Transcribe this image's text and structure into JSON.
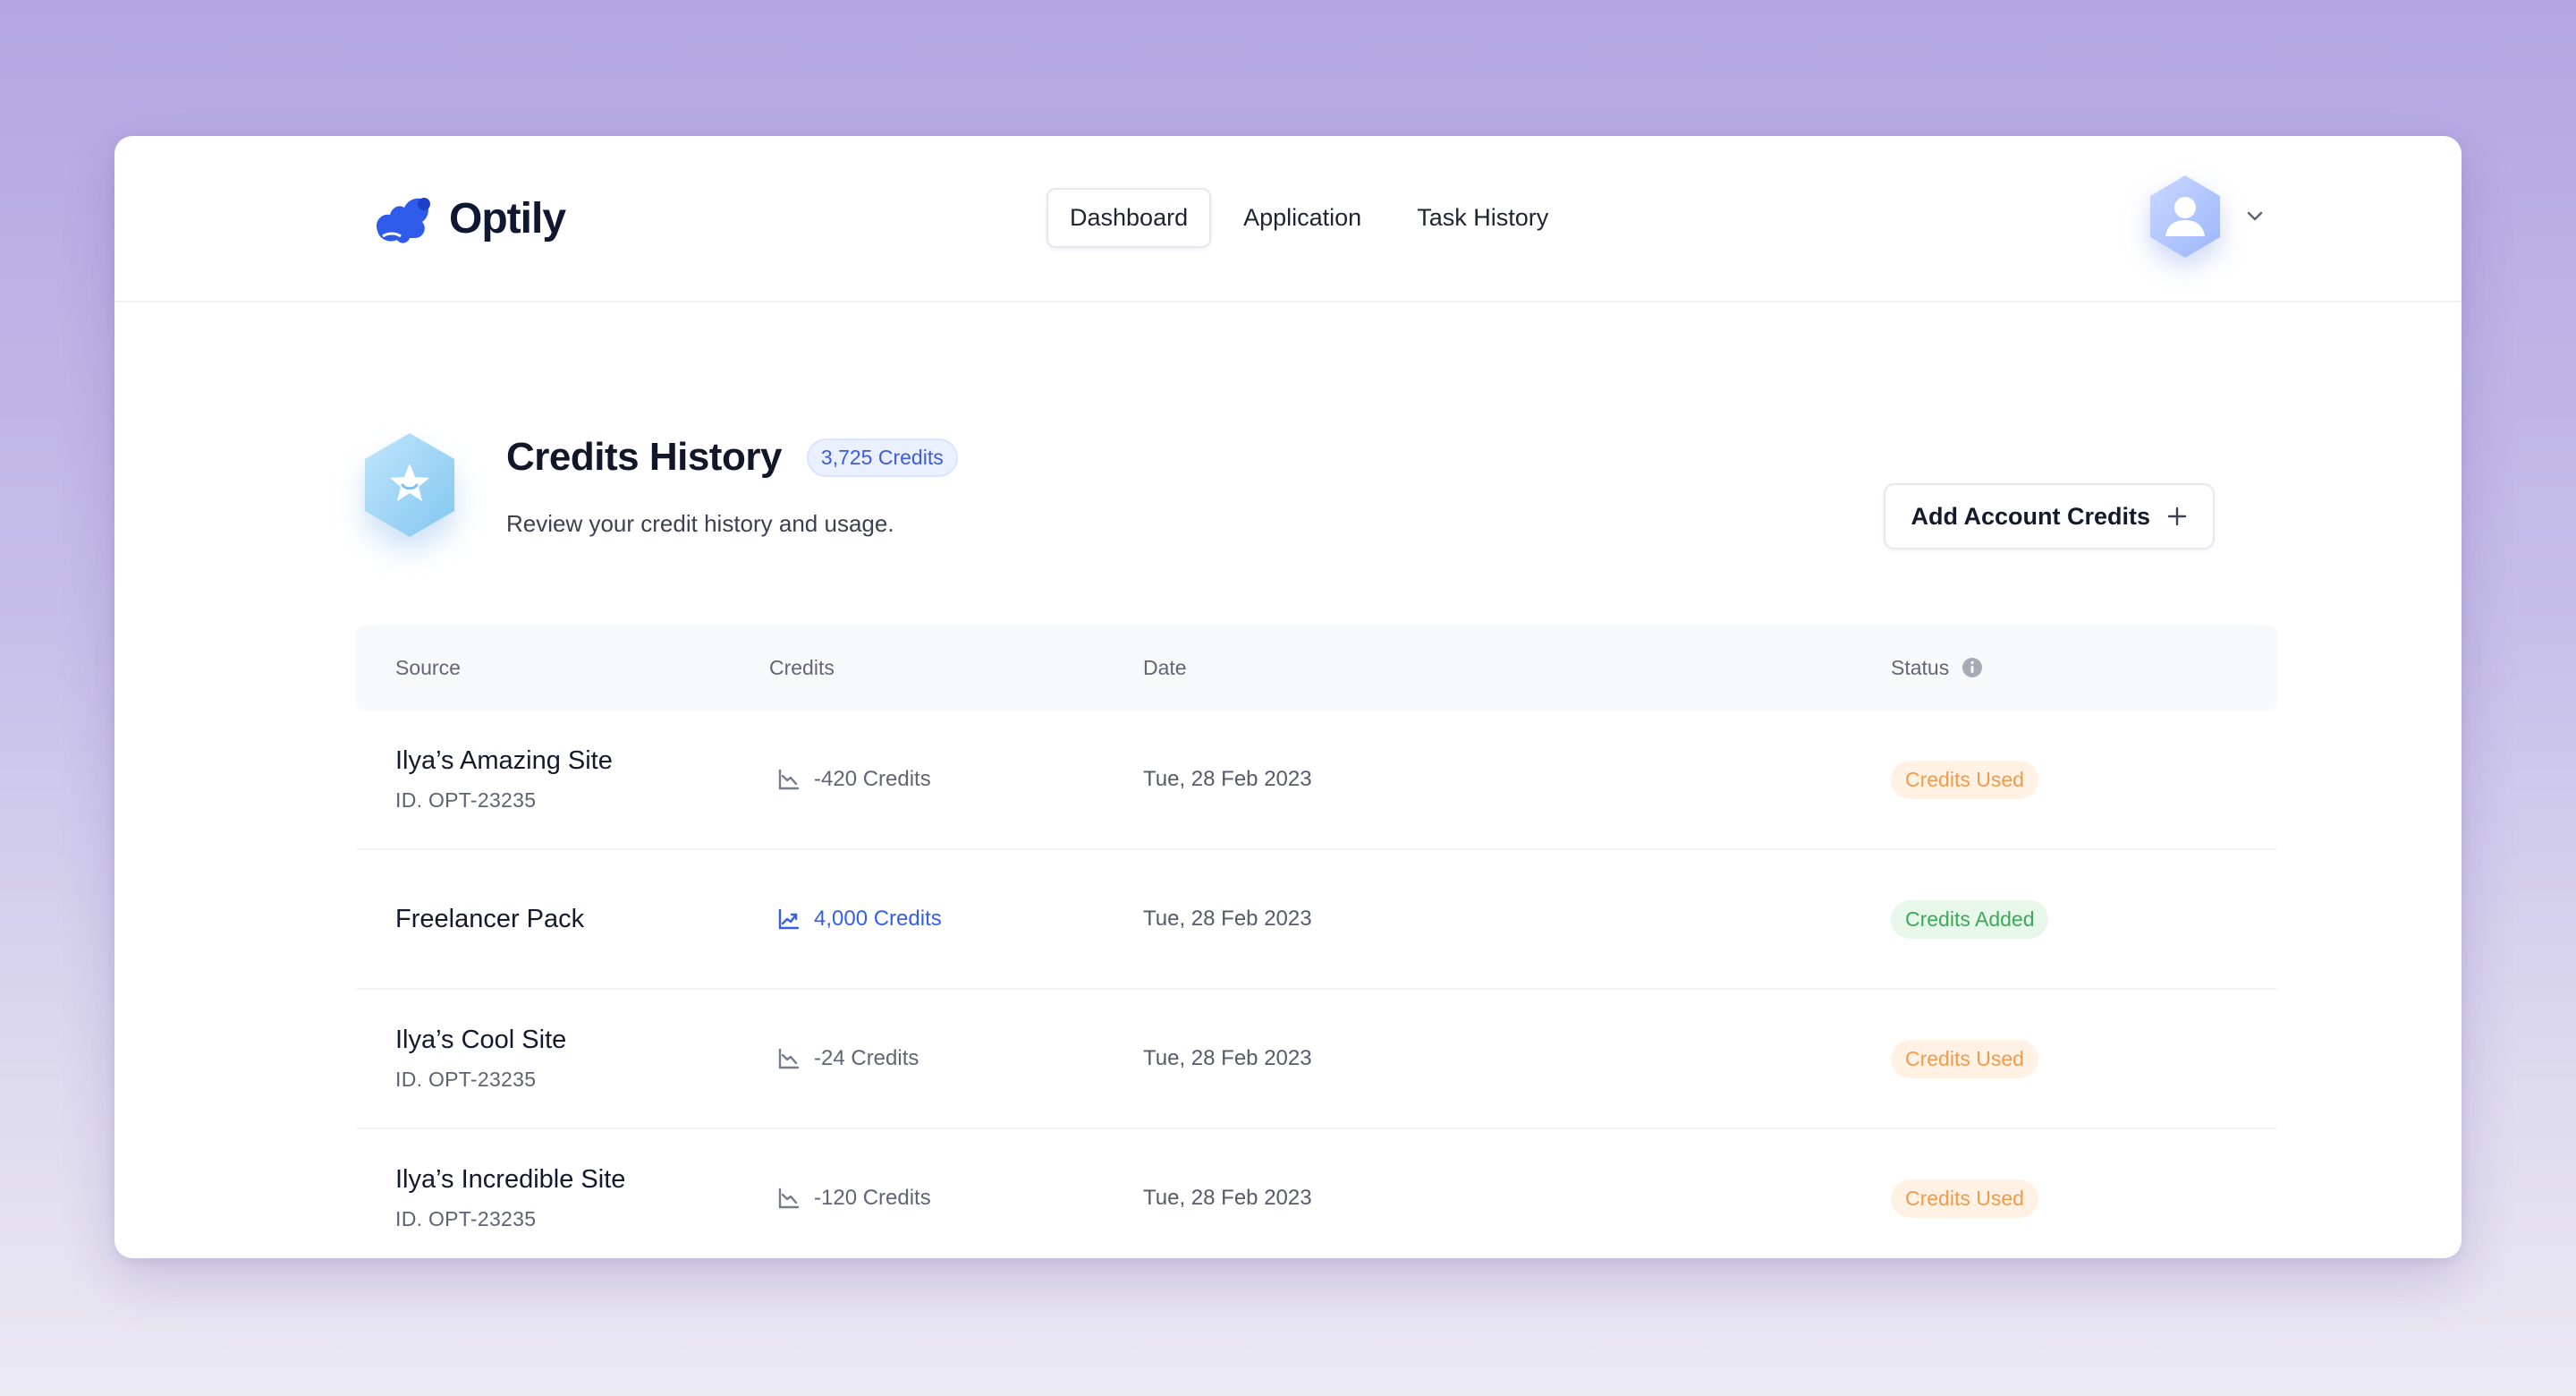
{
  "app": {
    "name": "Optily"
  },
  "nav": {
    "items": [
      "Dashboard",
      "Application",
      "Task History"
    ],
    "active": "Dashboard"
  },
  "header": {
    "title": "Credits History",
    "credits_badge": "3,725 Credits",
    "subtitle": "Review your credit history and usage.",
    "add_button": "Add Account Credits"
  },
  "table": {
    "columns": {
      "source": "Source",
      "credits": "Credits",
      "date": "Date",
      "status": "Status"
    },
    "rows": [
      {
        "source": "Ilya’s Amazing Site",
        "id": "ID. OPT-23235",
        "credits": "-420 Credits",
        "trend": "down",
        "date": "Tue, 28 Feb 2023",
        "status": "Credits Used"
      },
      {
        "source": "Freelancer Pack",
        "id": "",
        "credits": "4,000 Credits",
        "trend": "up",
        "date": "Tue, 28 Feb 2023",
        "status": "Credits Added"
      },
      {
        "source": "Ilya’s Cool Site",
        "id": "ID. OPT-23235",
        "credits": "-24 Credits",
        "trend": "down",
        "date": "Tue, 28 Feb 2023",
        "status": "Credits Used"
      },
      {
        "source": "Ilya’s Incredible Site",
        "id": "ID. OPT-23235",
        "credits": "-120 Credits",
        "trend": "down",
        "date": "Tue, 28 Feb 2023",
        "status": "Credits Used"
      }
    ]
  },
  "colors": {
    "brand": "#2f5bea",
    "status_used": "#f39a4a",
    "status_added": "#3ea85a",
    "credit_positive": "#3560e6"
  },
  "icons": [
    "optily-logo-icon",
    "user-avatar-icon",
    "chevron-down-icon",
    "star-badge-icon",
    "plus-icon",
    "info-icon",
    "trend-down-icon",
    "trend-up-icon"
  ]
}
